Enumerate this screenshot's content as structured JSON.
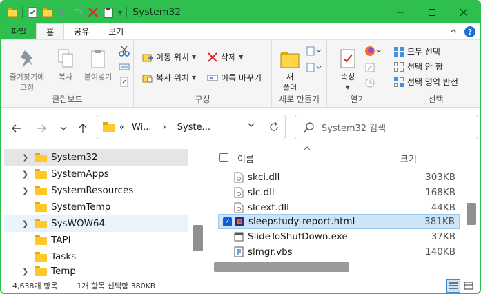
{
  "window": {
    "title": "System32"
  },
  "ribbon_tabs": [
    "파일",
    "홈",
    "공유",
    "보기"
  ],
  "clipboard": {
    "pin_line1": "즐겨찾기에",
    "pin_line2": "고정",
    "copy": "복사",
    "paste": "붙여넣기",
    "label": "클립보드"
  },
  "organize": {
    "move_to": "이동 위치",
    "copy_to": "복사 위치",
    "delete": "삭제",
    "rename": "이름 바꾸기",
    "label": "구성"
  },
  "new_group": {
    "new_folder_line1": "새",
    "new_folder_line2": "폴더",
    "label": "새로 만들기"
  },
  "open_group": {
    "properties": "속성",
    "label": "열기"
  },
  "select_group": {
    "select_all": "모두 선택",
    "select_none": "선택 안 함",
    "invert": "선택 영역 반전",
    "label": "선택"
  },
  "address": {
    "chevron": "«",
    "seg1": "Wi...",
    "sep": "›",
    "seg2": "Syste...",
    "search_placeholder": "System32 검색"
  },
  "tree": [
    {
      "name": "System32",
      "expandable": true,
      "state": "selected"
    },
    {
      "name": "SystemApps",
      "expandable": true,
      "state": ""
    },
    {
      "name": "SystemResources",
      "expandable": true,
      "state": ""
    },
    {
      "name": "SystemTemp",
      "expandable": false,
      "state": ""
    },
    {
      "name": "SysWOW64",
      "expandable": true,
      "state": "hover"
    },
    {
      "name": "TAPI",
      "expandable": false,
      "state": ""
    },
    {
      "name": "Tasks",
      "expandable": false,
      "state": ""
    },
    {
      "name": "Temp",
      "expandable": true,
      "state": ""
    }
  ],
  "columns": {
    "name": "이름",
    "size": "크기"
  },
  "files": [
    {
      "name": "skci.dll",
      "size": "303KB",
      "type": "dll",
      "selected": false
    },
    {
      "name": "slc.dll",
      "size": "168KB",
      "type": "dll",
      "selected": false
    },
    {
      "name": "slcext.dll",
      "size": "44KB",
      "type": "dll",
      "selected": false
    },
    {
      "name": "sleepstudy-report.html",
      "size": "381KB",
      "type": "html",
      "selected": true
    },
    {
      "name": "SlideToShutDown.exe",
      "size": "37KB",
      "type": "exe",
      "selected": false
    },
    {
      "name": "slmgr.vbs",
      "size": "140KB",
      "type": "vbs",
      "selected": false
    }
  ],
  "status": {
    "count": "4,638개 항목",
    "selection": "1개 항목 선택함 380KB"
  },
  "colors": {
    "titlebar": "#2fbf4f",
    "selection": "#cce4f7",
    "folder": "#ffc92b"
  }
}
